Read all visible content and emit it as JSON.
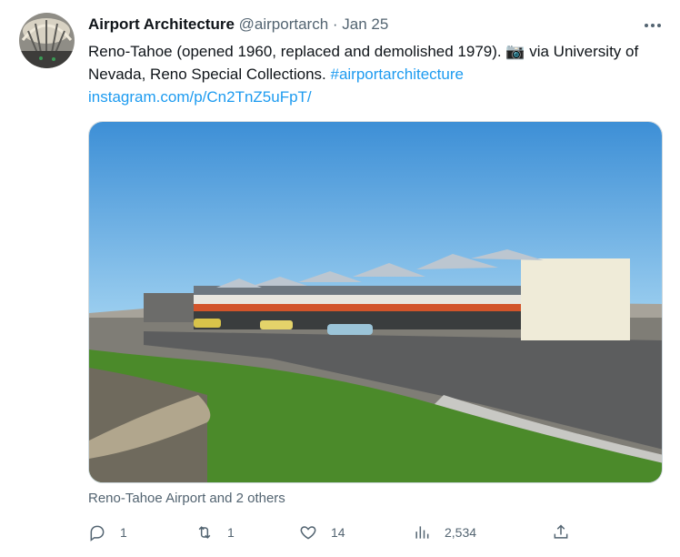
{
  "tweet": {
    "author_name": "Airport Architecture",
    "handle": "@airportarch",
    "separator": "·",
    "date": "Jan 25",
    "text": "Reno-Tahoe (opened 1960, replaced and demolished 1979). 📷 via University of Nevada, Reno Special Collections.",
    "hashtag": "#airportarchitecture",
    "url": "instagram.com/p/Cn2TnZ5uFpT/",
    "media_caption": "Reno-Tahoe Airport and 2 others"
  },
  "actions": {
    "reply_count": "1",
    "retweet_count": "1",
    "like_count": "14",
    "views_count": "2,534"
  },
  "icons": {
    "avatar": "airport-terminal-ceiling-avatar",
    "more": "more-icon",
    "reply": "reply-icon",
    "retweet": "retweet-icon",
    "like": "like-icon",
    "views": "views-icon",
    "share": "share-icon"
  },
  "colors": {
    "link": "#1d9bf0",
    "secondary_text": "#536471"
  }
}
